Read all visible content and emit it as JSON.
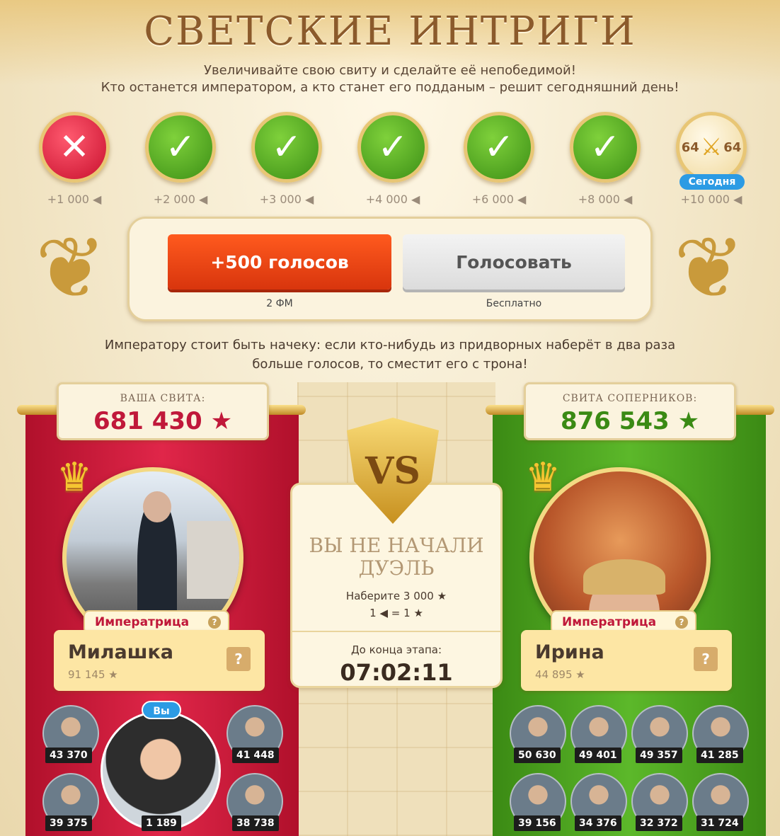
{
  "title": "СВЕТСКИЕ ИНТРИГИ",
  "subtitle_line1": "Увеличивайте свою свиту и сделайте её непобедимой!",
  "subtitle_line2": "Кто останется императором, а кто станет его подданым – решит сегодняшний день!",
  "days": [
    {
      "status": "failed",
      "reward": "+1 000"
    },
    {
      "status": "done",
      "reward": "+2 000"
    },
    {
      "status": "done",
      "reward": "+3 000"
    },
    {
      "status": "done",
      "reward": "+4 000"
    },
    {
      "status": "done",
      "reward": "+6 000"
    },
    {
      "status": "done",
      "reward": "+8 000"
    },
    {
      "status": "today",
      "reward": "+10 000",
      "left_num": "64",
      "right_num": "64",
      "badge": "Сегодня"
    }
  ],
  "vote": {
    "paid_label": "+500 голосов",
    "paid_cost": "2 ФМ",
    "free_label": "Голосовать",
    "free_cost": "Бесплатно"
  },
  "warning_line1": "Императору стоит быть начеку: если кто-нибудь из придворных наберёт в два раза",
  "warning_line2": "больше голосов, то сместит его с трона!",
  "your_side": {
    "label": "ВАША СВИТА:",
    "score": "681 430",
    "rank": "Императрица",
    "name": "Милашка",
    "name_score": "91 145",
    "you_badge": "Вы",
    "followers": [
      "43 370",
      "41 448",
      "39 375",
      "1 189",
      "38 738"
    ]
  },
  "rival_side": {
    "label": "СВИТА СОПЕРНИКОВ:",
    "score": "876 543",
    "rank": "Императрица",
    "name": "Ирина",
    "name_score": "44 895",
    "followers": [
      "50 630",
      "49 401",
      "49 357",
      "41 285",
      "39 156",
      "34 376",
      "32 372",
      "31 724"
    ]
  },
  "vs": {
    "emblem": "VS",
    "status_line1": "ВЫ НЕ НАЧАЛИ",
    "status_line2": "ДУЭЛЬ",
    "need": "Наберите 3 000",
    "rate": "1",
    "rate_equals": "= 1",
    "timer_label": "До конца этапа:",
    "timer": "07:02:11"
  },
  "colors": {
    "accent_red": "#c0183a",
    "accent_green": "#3a8a14",
    "paid_button": "#e8441a",
    "today_badge": "#2c9be4"
  },
  "icons": {
    "failed": "cross-icon",
    "done": "check-icon",
    "today": "swords-icon",
    "vote": "megaphone-icon",
    "star": "star-icon",
    "gift": "gift-icon",
    "help": "question-icon"
  }
}
